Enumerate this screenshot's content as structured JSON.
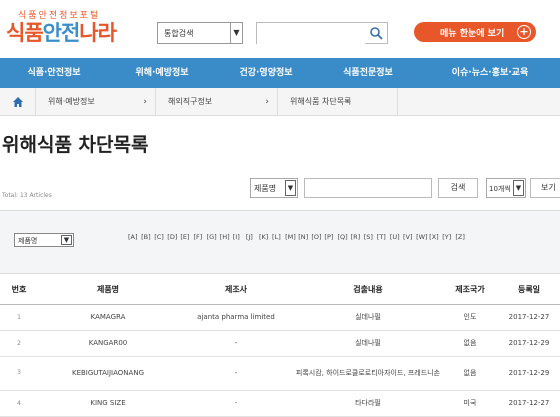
{
  "header": {
    "logo_tagline": "식품안전정보포털",
    "logo_part1": "식품",
    "logo_part2": "안전",
    "logo_part3": "나라",
    "scope_select": "통합검색",
    "search_placeholder": "",
    "menu_button": "메뉴 한눈에 보기",
    "plus_glyph": "+",
    "icons": {
      "search": "search-icon",
      "plus": "plus-circle-icon",
      "home": "home-icon"
    }
  },
  "gnb": {
    "items": [
      "식품·안전정보",
      "위해·예방정보",
      "건강·영양정보",
      "식품전문정보",
      "이슈·뉴스·홍보·교육"
    ]
  },
  "breadcrumb": [
    "위해·예방정보",
    "해외직구정보",
    "위해식품 차단목록"
  ],
  "page": {
    "title": "위해식품 차단목록",
    "total": "Total: 13 Articles"
  },
  "toolbar": {
    "field_select": "제품명",
    "keyword_value": "",
    "search_button": "검색",
    "page_size": "10개씩",
    "view_button": "보기"
  },
  "filter": {
    "index_select": "제품명",
    "letters": [
      "[A]",
      "[B]",
      "[C]",
      "[D]",
      "[E]",
      "[F]",
      "[G]",
      "[H]",
      "[I]",
      "[J]",
      "[K]",
      "[L]",
      "[M]",
      "[N]",
      "[O]",
      "[P]",
      "[Q]",
      "[R]",
      "[S]",
      "[T]",
      "[U]",
      "[V]",
      "[W]",
      "[X]",
      "[Y]",
      "[Z]"
    ]
  },
  "table": {
    "columns": [
      "번호",
      "제품명",
      "제조사",
      "검출내용",
      "제조국가",
      "등록일"
    ],
    "rows": [
      [
        "1",
        "KAMAGRA",
        "ajanta pharma limited",
        "실데나필",
        "인도",
        "2017-12-27"
      ],
      [
        "2",
        "KANGAR00",
        "-",
        "실데나필",
        "없음",
        "2017-12-29"
      ],
      [
        "3",
        "KEBIGUTAIJIAONANG",
        "-",
        "피록시캄, 하이드로클로로티아자이드, 프레드니손",
        "없음",
        "2017-12-29"
      ],
      [
        "4",
        "KING SIZE",
        "-",
        "타다라필",
        "미국",
        "2017-12-27"
      ]
    ]
  },
  "colors": {
    "accent_orange": "#e8572a",
    "nav_blue": "#3a8cc8",
    "logo_blue": "#3d8fc9"
  }
}
